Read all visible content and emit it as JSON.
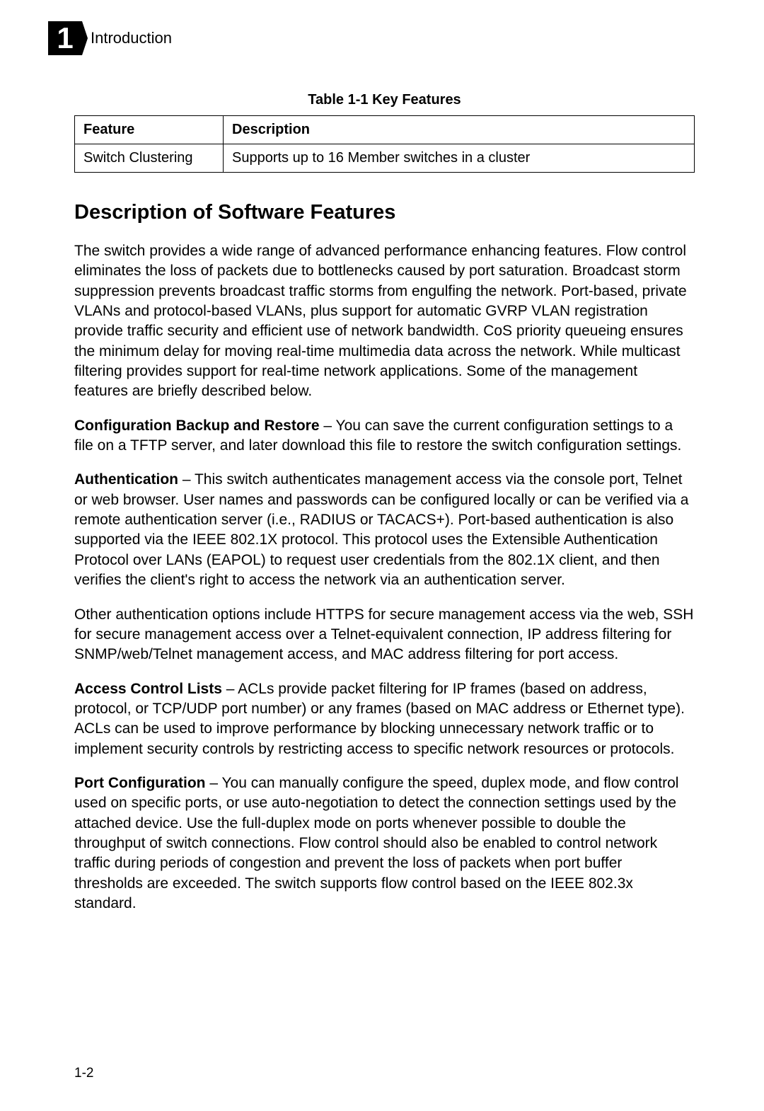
{
  "header": {
    "chapter_number": "1",
    "chapter_title": "Introduction"
  },
  "table": {
    "caption": "Table 1-1  Key Features",
    "headers": [
      "Feature",
      "Description"
    ],
    "rows": [
      {
        "feature": "Switch Clustering",
        "description": "Supports up to 16 Member switches in a cluster"
      }
    ]
  },
  "section_heading": "Description of Software Features",
  "intro_paragraph": "The switch provides a wide range of advanced performance enhancing features. Flow control eliminates the loss of packets due to bottlenecks caused by port saturation. Broadcast storm suppression prevents broadcast traffic storms from engulfing the network. Port-based, private VLANs and protocol-based VLANs, plus support for automatic GVRP VLAN registration provide traffic security and efficient use of network bandwidth. CoS priority queueing ensures the minimum delay for moving real-time multimedia data across the network. While multicast filtering provides support for real-time network applications. Some of the management features are briefly described below.",
  "features": [
    {
      "label": "Configuration Backup and Restore",
      "text": " – You can save the current configuration settings to a file on a TFTP server, and later download this file to restore the switch configuration settings."
    },
    {
      "label": "Authentication",
      "text": " – This switch authenticates management access via the console port, Telnet or web browser. User names and passwords can be configured locally or can be verified via a remote authentication server (i.e., RADIUS or TACACS+). Port-based authentication is also supported via the IEEE 802.1X protocol. This protocol uses the Extensible Authentication Protocol over LANs (EAPOL) to request user credentials from the 802.1X client, and then verifies the client's right to access the network via an authentication server."
    },
    {
      "label": "",
      "text": "Other authentication options include HTTPS for secure management access via the web, SSH for secure management access over a Telnet-equivalent connection, IP address filtering for SNMP/web/Telnet management access, and MAC address filtering for port access."
    },
    {
      "label": "Access Control Lists",
      "text": " – ACLs provide packet filtering for IP frames (based on address, protocol, or TCP/UDP port number) or any frames (based on MAC address or Ethernet type). ACLs can be used to improve performance by blocking unnecessary network traffic or to implement security controls by restricting access to specific network resources or protocols."
    },
    {
      "label": "Port Configuration",
      "text": " – You can manually configure the speed, duplex mode, and flow control used on specific ports, or use auto-negotiation to detect the connection settings used by the attached device. Use the full-duplex mode on ports whenever possible to double the throughput of switch connections. Flow control should also be enabled to control network traffic during periods of congestion and prevent the loss of packets when port buffer thresholds are exceeded. The switch supports flow control based on the IEEE 802.3x standard."
    }
  ],
  "page_number": "1-2"
}
